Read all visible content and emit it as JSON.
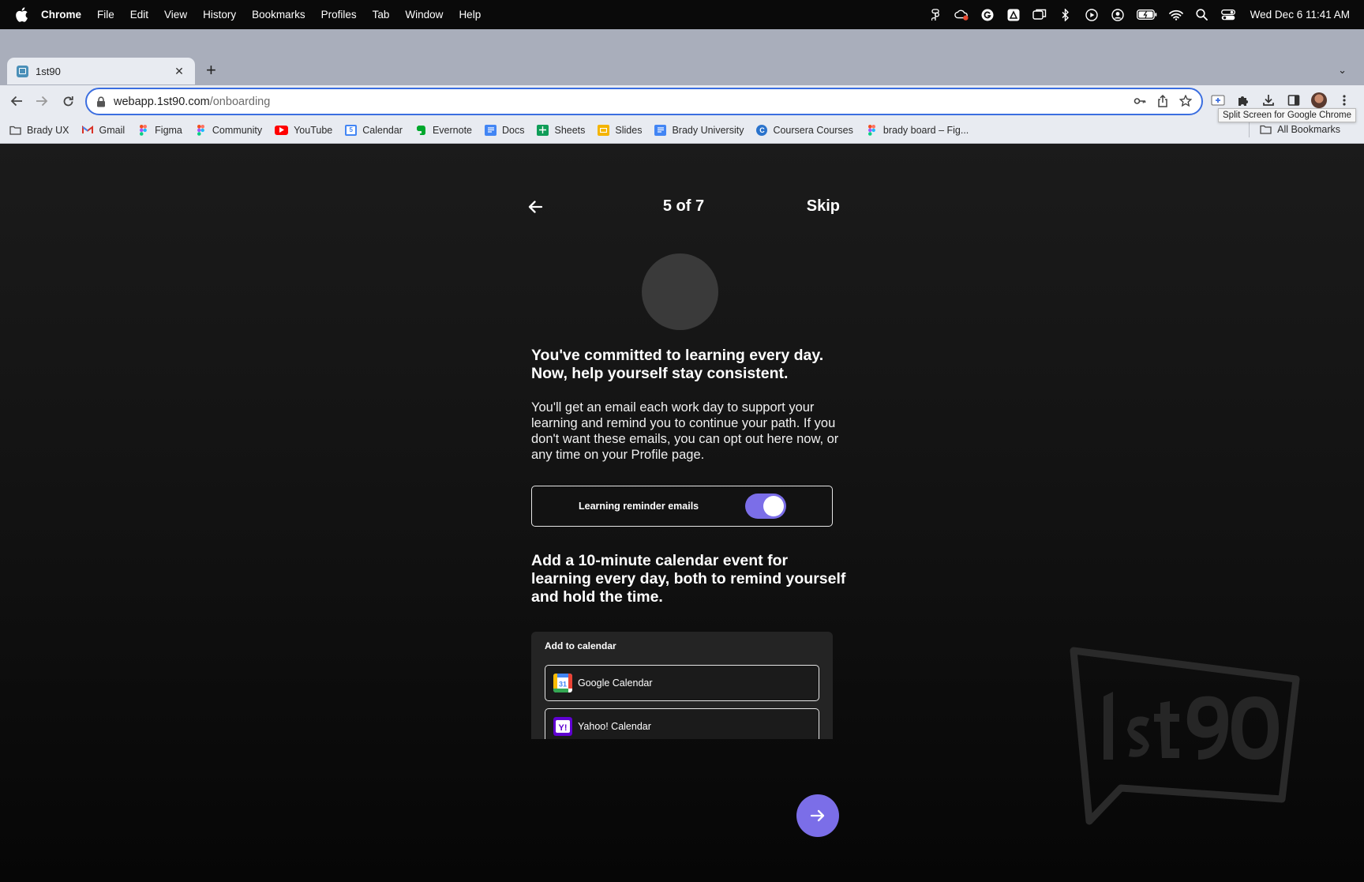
{
  "menubar": {
    "items": [
      "Chrome",
      "File",
      "Edit",
      "View",
      "History",
      "Bookmarks",
      "Profiles",
      "Tab",
      "Window",
      "Help"
    ],
    "clock": "Wed Dec 6  11:41 AM"
  },
  "browser": {
    "tab_title": "1st90",
    "url_host": "webapp.1st90.com",
    "url_path": "/onboarding",
    "tooltip": "Split Screen for Google Chrome"
  },
  "bookmarks": {
    "items": [
      "Brady UX",
      "Gmail",
      "Figma",
      "Community",
      "YouTube",
      "Calendar",
      "Evernote",
      "Docs",
      "Sheets",
      "Slides",
      "Brady University",
      "Coursera Courses",
      "brady board – Fig..."
    ],
    "all_bookmarks": "All Bookmarks"
  },
  "onboarding": {
    "step": "5 of 7",
    "skip": "Skip",
    "heading1_line1": "You've committed to learning every day.",
    "heading1_line2": "Now, help yourself stay consistent.",
    "paragraph": "You'll get an email each work day to support your learning and remind you to continue your path. If you don't want these emails, you can opt out here now, or any time on your Profile page.",
    "toggle_label": "Learning reminder emails",
    "toggle_on": true,
    "heading2": "Add a 10-minute calendar event for learning every day, both to remind yourself and hold the time.",
    "calendar": {
      "title": "Add to calendar",
      "options": [
        "Google Calendar",
        "Yahoo! Calendar"
      ]
    }
  },
  "colors": {
    "accent": "#7b6ee8",
    "page_bg": "#141414",
    "omnibox_border": "#3b6ee0"
  }
}
